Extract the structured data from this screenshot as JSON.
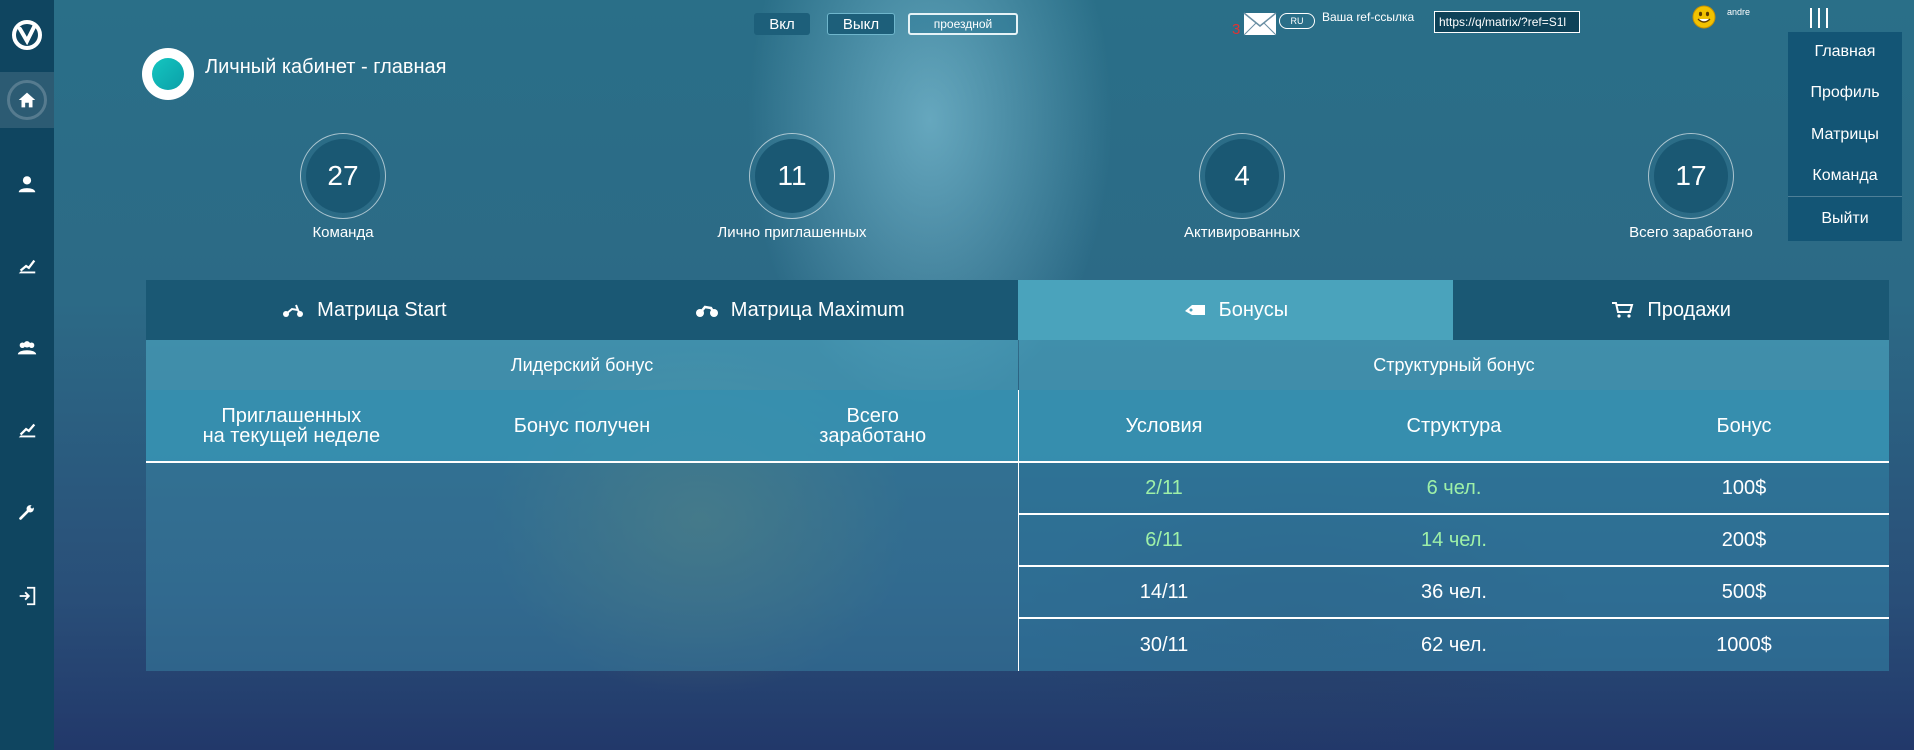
{
  "topbar": {
    "btn_on": "Вкл",
    "btn_off": "Выкл",
    "btn_pass": "проездной",
    "mail_count": "3",
    "lang": "RU",
    "ref_label": "Ваша ref-ссылка",
    "ref_value": "https://q/matrix/?ref=S1l",
    "user_name": "andre"
  },
  "menu": {
    "items": [
      "Главная",
      "Профиль",
      "Матрицы",
      "Команда",
      "Выйти"
    ]
  },
  "sidebar": {
    "icons": [
      "home-icon",
      "user-icon",
      "chart-icon",
      "team-icon",
      "chart2-icon",
      "wrench-icon",
      "exit-icon"
    ]
  },
  "header": {
    "title": "Личный кабинет - главная"
  },
  "stats": [
    {
      "value": "27",
      "label": "Команда"
    },
    {
      "value": "11",
      "label": "Лично приглашенных"
    },
    {
      "value": "4",
      "label": "Активированных"
    },
    {
      "value": "17",
      "label": "Всего заработано"
    }
  ],
  "tabs": [
    {
      "label": "Матрица Start",
      "icon": "scooter-icon"
    },
    {
      "label": "Матрица Maximum",
      "icon": "motorbike-icon"
    },
    {
      "label": "Бонусы",
      "icon": "gift-icon"
    },
    {
      "label": "Продажи",
      "icon": "cart-icon"
    }
  ],
  "leader_bonus": {
    "title": "Лидерский бонус",
    "headers": [
      "Приглашенных\nна текущей неделе",
      "Бонус получен",
      "Всего\nзаработано"
    ]
  },
  "structure_bonus": {
    "title": "Структурный бонус",
    "headers": [
      "Условия",
      "Структура",
      "Бонус"
    ],
    "rows": [
      {
        "condition": "2/11",
        "structure": "6 чел.",
        "bonus": "100$",
        "achieved": true
      },
      {
        "condition": "6/11",
        "structure": "14 чел.",
        "bonus": "200$",
        "achieved": true
      },
      {
        "condition": "14/11",
        "structure": "36 чел.",
        "bonus": "500$",
        "achieved": false
      },
      {
        "condition": "30/11",
        "structure": "62 чел.",
        "bonus": "1000$",
        "achieved": false
      }
    ]
  },
  "colors": {
    "sidebar": "#0f4560",
    "tab_active": "#4aa3bc",
    "achieved": "#9ef0a8",
    "mail_count": "#e03232"
  }
}
